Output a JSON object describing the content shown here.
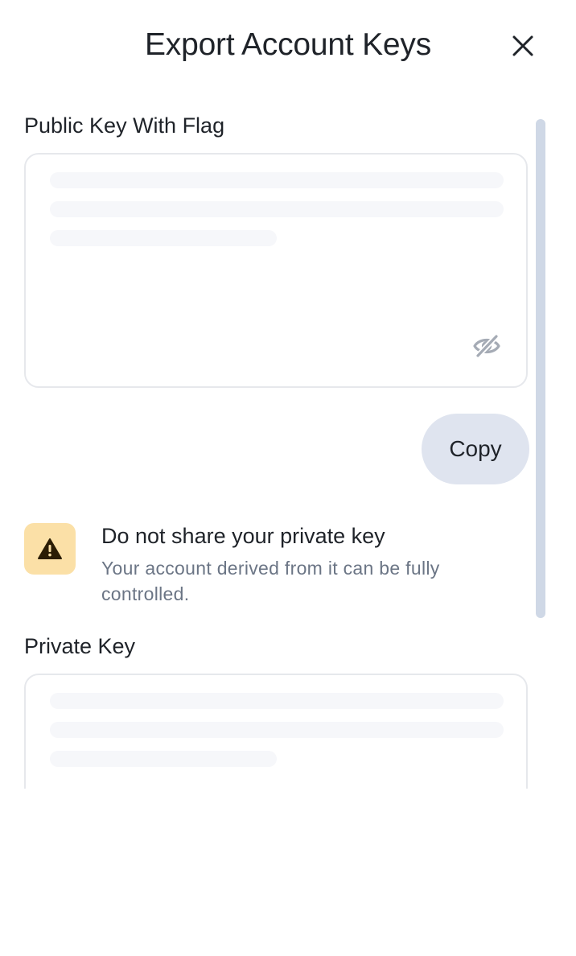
{
  "header": {
    "title": "Export Account Keys"
  },
  "public_key": {
    "label": "Public Key With Flag",
    "copy_label": "Copy"
  },
  "warning": {
    "title": "Do not share your private key",
    "description": "Your account derived from it can be fully controlled."
  },
  "private_key": {
    "label": "Private Key"
  },
  "colors": {
    "copy_button_bg": "#dfe4ef",
    "warning_icon_bg": "#fbe0a7",
    "scrollbar": "#cfd8e6",
    "skeleton": "#f6f7fa"
  },
  "icons": {
    "close": "close-icon",
    "visibility": "eye-off-icon",
    "warning": "warning-triangle-icon"
  }
}
